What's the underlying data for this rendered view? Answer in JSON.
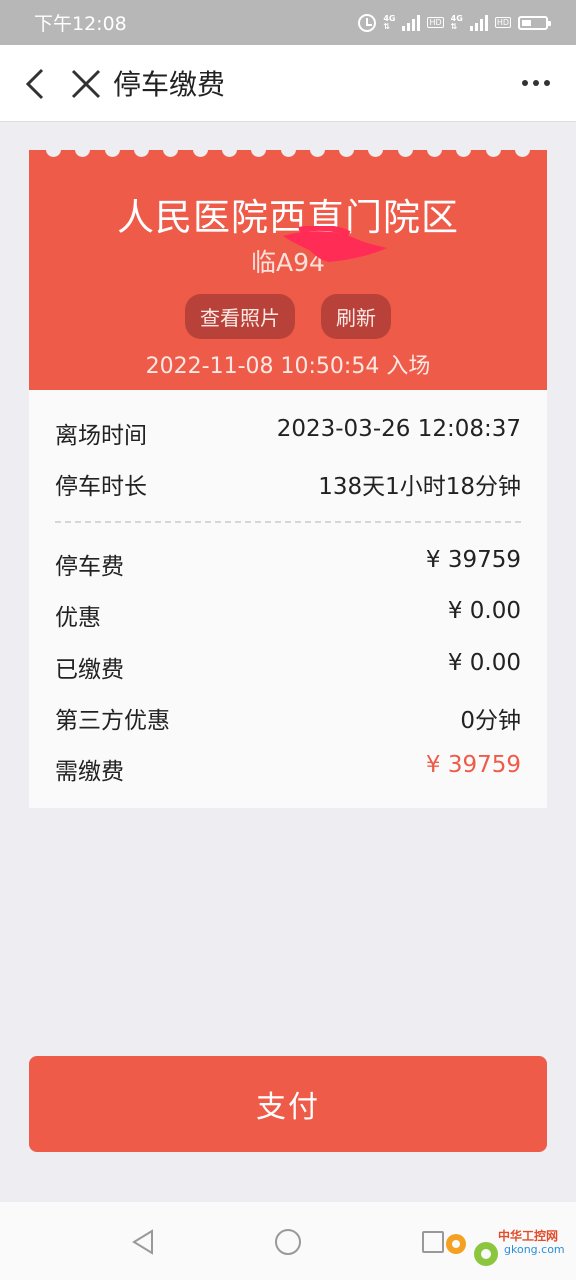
{
  "status_bar": {
    "time": "下午12:08",
    "network": "4G",
    "hd": "HD"
  },
  "nav": {
    "title": "停车缴费"
  },
  "ticket": {
    "lot_name": "人民医院西直门院区",
    "plate": "临A94",
    "buttons": {
      "photos": "查看照片",
      "refresh": "刷新"
    },
    "entry": "2022-11-08 10:50:54 入场"
  },
  "details": {
    "exit_time": {
      "label": "离场时间",
      "value": "2023-03-26 12:08:37"
    },
    "duration": {
      "label": "停车时长",
      "value": "138天1小时18分钟"
    },
    "fee": {
      "label": "停车费",
      "value": "¥ 39759"
    },
    "discount": {
      "label": "优惠",
      "value": "¥ 0.00"
    },
    "paid": {
      "label": "已缴费",
      "value": "¥ 0.00"
    },
    "third_party": {
      "label": "第三方优惠",
      "value": "0分钟"
    },
    "due": {
      "label": "需缴费",
      "value": "¥ 39759"
    }
  },
  "pay_button": "支付",
  "watermark": {
    "title": "中华工控网",
    "site": "gkong.com"
  },
  "colors": {
    "accent": "#ef5b49",
    "accent_dark": "#b8423a",
    "background": "#ededf2"
  }
}
